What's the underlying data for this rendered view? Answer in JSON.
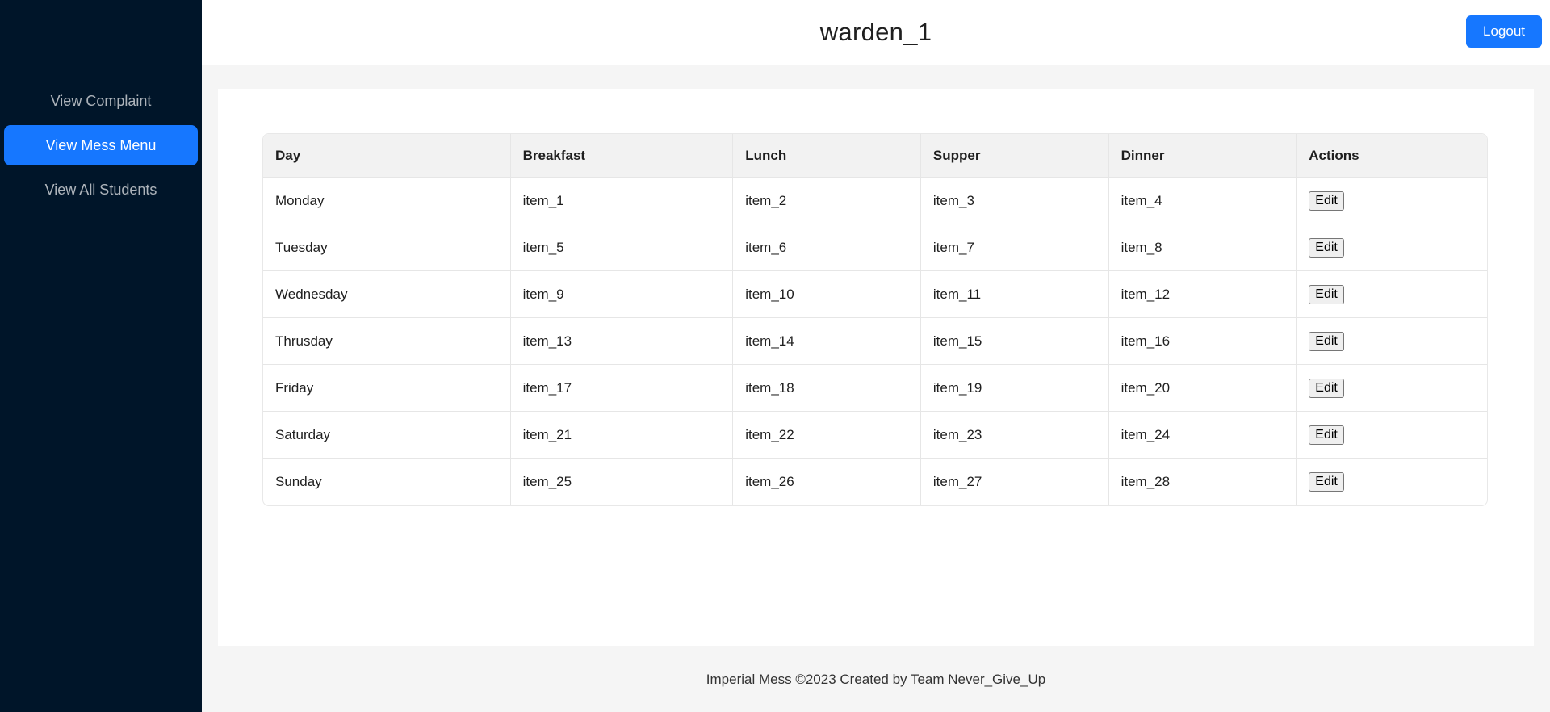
{
  "sidebar": {
    "items": [
      {
        "label": "View Complaint",
        "active": false
      },
      {
        "label": "View Mess Menu",
        "active": true
      },
      {
        "label": "View All Students",
        "active": false
      }
    ]
  },
  "header": {
    "title": "warden_1",
    "logout_label": "Logout"
  },
  "table": {
    "columns": [
      "Day",
      "Breakfast",
      "Lunch",
      "Supper",
      "Dinner",
      "Actions"
    ],
    "edit_label": "Edit",
    "rows": [
      {
        "day": "Monday",
        "breakfast": "item_1",
        "lunch": "item_2",
        "supper": "item_3",
        "dinner": "item_4"
      },
      {
        "day": "Tuesday",
        "breakfast": "item_5",
        "lunch": "item_6",
        "supper": "item_7",
        "dinner": "item_8"
      },
      {
        "day": "Wednesday",
        "breakfast": "item_9",
        "lunch": "item_10",
        "supper": "item_11",
        "dinner": "item_12"
      },
      {
        "day": "Thrusday",
        "breakfast": "item_13",
        "lunch": "item_14",
        "supper": "item_15",
        "dinner": "item_16"
      },
      {
        "day": "Friday",
        "breakfast": "item_17",
        "lunch": "item_18",
        "supper": "item_19",
        "dinner": "item_20"
      },
      {
        "day": "Saturday",
        "breakfast": "item_21",
        "lunch": "item_22",
        "supper": "item_23",
        "dinner": "item_24"
      },
      {
        "day": "Sunday",
        "breakfast": "item_25",
        "lunch": "item_26",
        "supper": "item_27",
        "dinner": "item_28"
      }
    ]
  },
  "footer": {
    "text": "Imperial Mess ©2023 Created by Team Never_Give_Up"
  },
  "colors": {
    "sidebar_bg": "#001529",
    "accent": "#1677ff"
  }
}
